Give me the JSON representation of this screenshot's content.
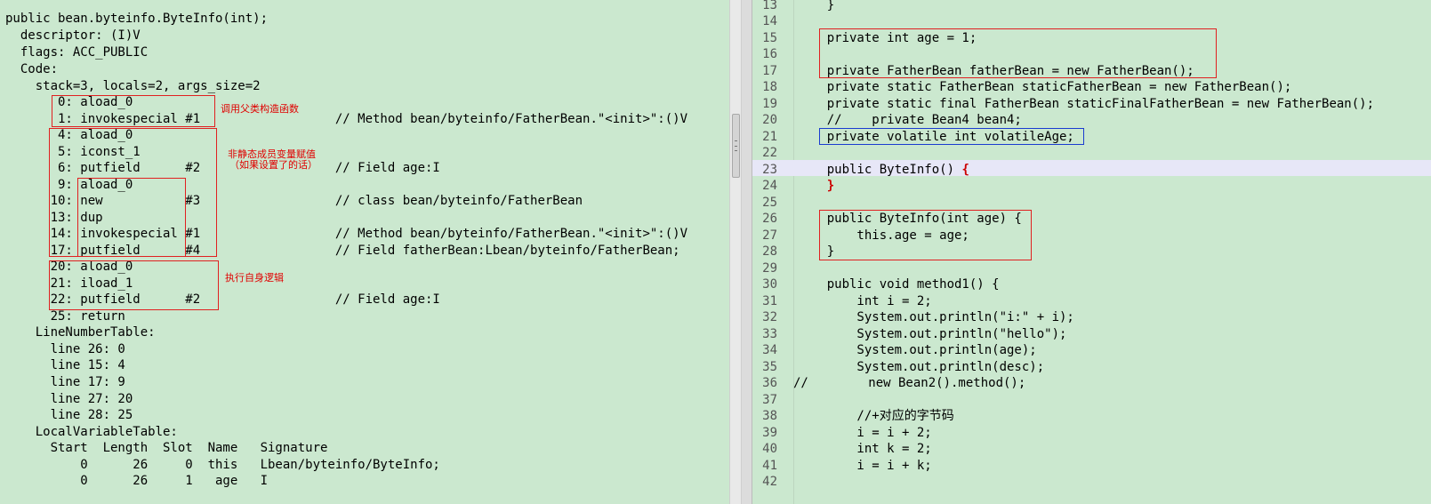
{
  "left": {
    "lines": [
      "public bean.byteinfo.ByteInfo(int);",
      "  descriptor: (I)V",
      "  flags: ACC_PUBLIC",
      "  Code:",
      "    stack=3, locals=2, args_size=2",
      "       0: aload_0",
      "       1: invokespecial #1                  // Method bean/byteinfo/FatherBean.\"<init>\":()V",
      "       4: aload_0",
      "       5: iconst_1",
      "       6: putfield      #2                  // Field age:I",
      "       9: aload_0",
      "      10: new           #3                  // class bean/byteinfo/FatherBean",
      "      13: dup",
      "      14: invokespecial #1                  // Method bean/byteinfo/FatherBean.\"<init>\":()V",
      "      17: putfield      #4                  // Field fatherBean:Lbean/byteinfo/FatherBean;",
      "      20: aload_0",
      "      21: iload_1",
      "      22: putfield      #2                  // Field age:I",
      "      25: return",
      "    LineNumberTable:",
      "      line 26: 0",
      "      line 15: 4",
      "      line 17: 9",
      "      line 27: 20",
      "      line 28: 25",
      "    LocalVariableTable:",
      "      Start  Length  Slot  Name   Signature",
      "          0      26     0  this   Lbean/byteinfo/ByteInfo;",
      "          0      26     1   age   I"
    ],
    "annotations": {
      "super_ctor": "调用父类构造函数",
      "field_init": "非静态成员变量赋值",
      "field_init_note": "（如果设置了的话）",
      "own_logic": "执行自身逻辑"
    }
  },
  "right": {
    "rows": [
      {
        "num": "13",
        "text": "    }"
      },
      {
        "num": "14",
        "text": ""
      },
      {
        "num": "15",
        "text": "    private int age = 1;"
      },
      {
        "num": "16",
        "text": ""
      },
      {
        "num": "17",
        "text": "    private FatherBean fatherBean = new FatherBean();"
      },
      {
        "num": "18",
        "text": "    private static FatherBean staticFatherBean = new FatherBean();"
      },
      {
        "num": "19",
        "text": "    private static final FatherBean staticFinalFatherBean = new FatherBean();"
      },
      {
        "num": "20",
        "text": "    //    private Bean4 bean4;"
      },
      {
        "num": "21",
        "text": "    private volatile int volatileAge;"
      },
      {
        "num": "22",
        "text": ""
      },
      {
        "num": "23",
        "text": "    public ByteInfo() "
      },
      {
        "num": "24",
        "text": "    "
      },
      {
        "num": "25",
        "text": ""
      },
      {
        "num": "26",
        "text": "    public ByteInfo(int age) {"
      },
      {
        "num": "27",
        "text": "        this.age = age;"
      },
      {
        "num": "28",
        "text": "    }"
      },
      {
        "num": "29",
        "text": ""
      },
      {
        "num": "30",
        "text": "    public void method1() {"
      },
      {
        "num": "31",
        "text": "        int i = 2;"
      },
      {
        "num": "32",
        "text": "        System.out.println(\"i:\" + i);"
      },
      {
        "num": "33",
        "text": "        System.out.println(\"hello\");"
      },
      {
        "num": "34",
        "text": "        System.out.println(age);"
      },
      {
        "num": "35",
        "text": "        System.out.println(desc);"
      },
      {
        "num": "36",
        "text": "//        new Bean2().method();"
      },
      {
        "num": "37",
        "text": ""
      },
      {
        "num": "38",
        "text": "        //+对应的字节码"
      },
      {
        "num": "39",
        "text": "        i = i + 2;"
      },
      {
        "num": "40",
        "text": "        int k = 2;"
      },
      {
        "num": "41",
        "text": "        i = i + k;"
      },
      {
        "num": "42",
        "text": ""
      }
    ],
    "brace_open": "{",
    "brace_close": "}"
  },
  "colors": {
    "background": "#cbe8cf",
    "box_red": "#e02020",
    "box_blue": "#1a3cd0",
    "annotation": "#e00000",
    "current_line": "#e7e7f7"
  }
}
